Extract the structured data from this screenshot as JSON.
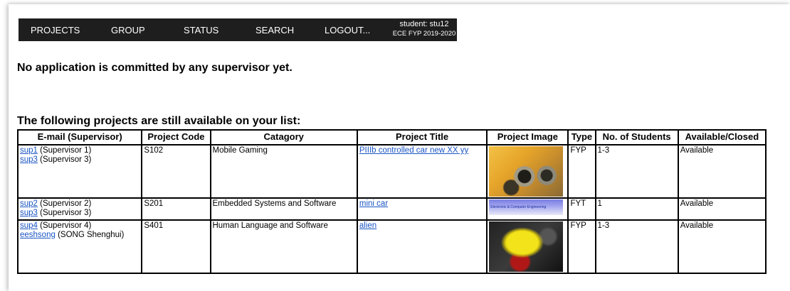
{
  "nav": {
    "items": [
      "PROJECTS",
      "GROUP",
      "STATUS",
      "SEARCH",
      "LOGOUT..."
    ],
    "user_line1": "student: stu12",
    "user_line2": "ECE FYP 2019-2020"
  },
  "message": "No application is committed by any supervisor yet.",
  "subheading": "The following projects are still available on your list:",
  "table": {
    "headers": [
      "E-mail (Supervisor)",
      "Project Code",
      "Catagory",
      "Project Title",
      "Project Image",
      "Type",
      "No. of Students",
      "Available/Closed"
    ],
    "rows": [
      {
        "supervisors": [
          {
            "link": "sup1",
            "name": " (Supervisor 1)"
          },
          {
            "link": "sup3",
            "name": " (Supervisor 3)"
          }
        ],
        "code": "S102",
        "category": "Mobile Gaming",
        "title": "PIIIb controlled car new XX yy",
        "type": "FYP",
        "students": "1-3",
        "status": "Available"
      },
      {
        "supervisors": [
          {
            "link": "sup2",
            "name": " (Supervisor 2)"
          },
          {
            "link": "sup3",
            "name": " (Supervisor 3)"
          }
        ],
        "code": "S201",
        "category": "Embedded Systems and Software",
        "title": "mini car",
        "image_caption": "Electronic & Computer Engineering",
        "type": "FYT",
        "students": "1",
        "status": "Available"
      },
      {
        "supervisors": [
          {
            "link": "sup4",
            "name": " (Supervisor 4)"
          },
          {
            "link": "eeshsong",
            "name": " (SONG Shenghui)"
          }
        ],
        "code": "S401",
        "category": "Human Language and Software",
        "title": "alien",
        "type": "FYP",
        "students": "1-3",
        "status": "Available"
      }
    ]
  },
  "colors": {
    "navbar": "#1e1e1e",
    "link": "#1a55c4"
  }
}
